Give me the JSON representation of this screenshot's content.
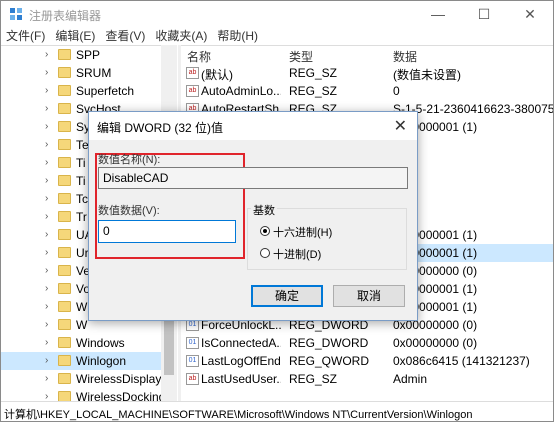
{
  "window": {
    "title": "注册表编辑器",
    "minimize": "—",
    "maximize": "☐",
    "close": "✕"
  },
  "menu": [
    "文件(F)",
    "编辑(E)",
    "查看(V)",
    "收藏夹(A)",
    "帮助(H)"
  ],
  "tree": [
    {
      "label": "SPP",
      "selected": false
    },
    {
      "label": "SRUM",
      "selected": false
    },
    {
      "label": "Superfetch",
      "selected": false
    },
    {
      "label": "SvcHost",
      "selected": false
    },
    {
      "label": "Sy",
      "selected": false
    },
    {
      "label": "Te",
      "selected": false
    },
    {
      "label": "Ti",
      "selected": false
    },
    {
      "label": "Ti",
      "selected": false
    },
    {
      "label": "Tc",
      "selected": false
    },
    {
      "label": "Tr",
      "selected": false
    },
    {
      "label": "UA",
      "selected": false
    },
    {
      "label": "Ur",
      "selected": false
    },
    {
      "label": "Ve",
      "selected": false
    },
    {
      "label": "Vo",
      "selected": false
    },
    {
      "label": "W",
      "selected": false
    },
    {
      "label": "W",
      "selected": false
    },
    {
      "label": "Windows",
      "selected": false
    },
    {
      "label": "Winlogon",
      "selected": true
    },
    {
      "label": "WirelessDisplay",
      "selected": false
    },
    {
      "label": "WirelessDocking",
      "selected": false
    }
  ],
  "list": {
    "headers": [
      "名称",
      "类型",
      "数据"
    ],
    "rows": [
      {
        "icon": "ab",
        "name": "(默认)",
        "type": "REG_SZ",
        "data": "(数值未设置)",
        "selected": false
      },
      {
        "icon": "ab",
        "name": "AutoAdminLo...",
        "type": "REG_SZ",
        "data": "0",
        "selected": false
      },
      {
        "icon": "ab",
        "name": "AutoRestartSh...",
        "type": "REG_SZ",
        "data": "S-1-5-21-2360416623-380075",
        "selected": false
      },
      {
        "icon": "bin",
        "name": "",
        "type": "",
        "data": "0x00000001 (1)",
        "selected": false
      },
      {
        "icon": "bin",
        "name": "",
        "type": "",
        "data": "",
        "selected": false
      },
      {
        "icon": "bin",
        "name": "",
        "type": "",
        "data": "",
        "selected": false
      },
      {
        "icon": "bin",
        "name": "",
        "type": "",
        "data": "",
        "selected": false
      },
      {
        "icon": "bin",
        "name": "",
        "type": "",
        "data": "",
        "selected": false
      },
      {
        "icon": "ab",
        "name": "",
        "type": "",
        "data": "in",
        "selected": false
      },
      {
        "icon": "bin",
        "name": "",
        "type": "",
        "data": "0x00000001 (1)",
        "selected": false
      },
      {
        "icon": "bin",
        "name": "",
        "type": "",
        "data": "0x00000001 (1)",
        "selected": true
      },
      {
        "icon": "bin",
        "name": "",
        "type": "",
        "data": "0x00000000 (0)",
        "selected": false
      },
      {
        "icon": "bin",
        "name": "",
        "type": "",
        "data": "0x00000001 (1)",
        "selected": false
      },
      {
        "icon": "bin",
        "name": "",
        "type": "",
        "data": "0x00000001 (1)",
        "selected": false
      },
      {
        "icon": "bin",
        "name": "ForceUnlockL...",
        "type": "REG_DWORD",
        "data": "0x00000000 (0)",
        "selected": false
      },
      {
        "icon": "bin",
        "name": "IsConnectedA...",
        "type": "REG_DWORD",
        "data": "0x00000000 (0)",
        "selected": false
      },
      {
        "icon": "bin",
        "name": "LastLogOffEnd...",
        "type": "REG_QWORD",
        "data": "0x086c6415 (141321237)",
        "selected": false
      },
      {
        "icon": "ab",
        "name": "LastUsedUser...",
        "type": "REG_SZ",
        "data": "Admin",
        "selected": false
      }
    ]
  },
  "status": "计算机\\HKEY_LOCAL_MACHINE\\SOFTWARE\\Microsoft\\Windows NT\\CurrentVersion\\Winlogon",
  "dialog": {
    "title": "编辑 DWORD (32 位)值",
    "close": "✕",
    "name_label": "数值名称(N):",
    "name_value": "DisableCAD",
    "data_label": "数值数据(V):",
    "data_value": "0",
    "base_label": "基数",
    "hex_label": "十六进制(H)",
    "dec_label": "十进制(D)",
    "base_selected": "hex",
    "ok": "确定",
    "cancel": "取消"
  }
}
